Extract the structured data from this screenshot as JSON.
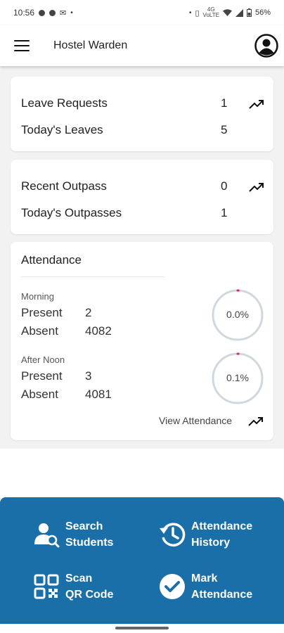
{
  "status_bar": {
    "time": "10:56",
    "battery": "56%",
    "network_top": "4G",
    "network_bottom": "VoLTE"
  },
  "app_bar": {
    "title": "Hostel Warden"
  },
  "leave_card": {
    "rows": [
      {
        "label": "Leave Requests",
        "value": "1"
      },
      {
        "label": "Today's Leaves",
        "value": "5"
      }
    ]
  },
  "outpass_card": {
    "rows": [
      {
        "label": "Recent Outpass",
        "value": "0"
      },
      {
        "label": "Today's Outpasses",
        "value": "1"
      }
    ]
  },
  "attendance": {
    "title": "Attendance",
    "morning": {
      "label": "Morning",
      "present_label": "Present",
      "present_value": "2",
      "absent_label": "Absent",
      "absent_value": "4082",
      "percent_text": "0.0%",
      "percent": 0.0
    },
    "afternoon": {
      "label": "After Noon",
      "present_label": "Present",
      "present_value": "3",
      "absent_label": "Absent",
      "absent_value": "4081",
      "percent_text": "0.1%",
      "percent": 0.1
    },
    "view_link": "View Attendance"
  },
  "actions": [
    {
      "line1": "Search",
      "line2": "Students",
      "icon": "search-students-icon"
    },
    {
      "line1": "Attendance",
      "line2": "History",
      "icon": "history-icon"
    },
    {
      "line1": "Scan",
      "line2": "QR Code",
      "icon": "qr-code-icon"
    },
    {
      "line1": "Mark",
      "line2": "Attendance",
      "icon": "check-circle-icon"
    }
  ],
  "colors": {
    "primary": "#1b6fa8",
    "ring_track": "#cfd8dc",
    "ring_progress": "#e91e63",
    "background": "#f2f2f2"
  }
}
